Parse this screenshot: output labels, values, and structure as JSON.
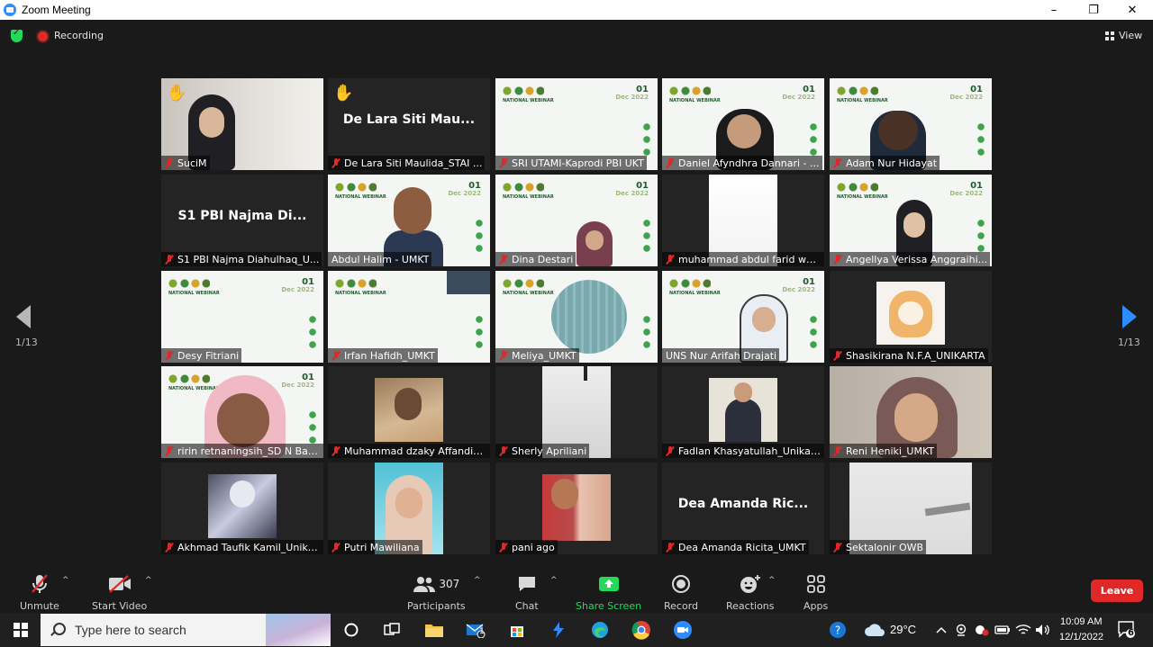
{
  "window": {
    "title": "Zoom Meeting",
    "minimize": "–",
    "maximize": "❐",
    "close": "✕"
  },
  "meeting": {
    "recording_label": "Recording",
    "view_label": "View"
  },
  "pager": {
    "left": "1/13",
    "right": "1/13"
  },
  "tiles": [
    {
      "name": "SuciM",
      "hand": true,
      "big": ""
    },
    {
      "name": "De Lara Siti Maulida_STAI ...",
      "hand": true,
      "big": "De Lara Siti Mau..."
    },
    {
      "name": "SRI UTAMI-Kaprodi PBI UKT",
      "hand": false,
      "big": ""
    },
    {
      "name": "Daniel Afyndhra Dannari - ...",
      "hand": false,
      "big": ""
    },
    {
      "name": "Adam Nur Hidayat",
      "hand": false,
      "big": ""
    },
    {
      "name": "S1 PBI Najma Diahulhaq_U...",
      "hand": false,
      "big": "S1 PBI Najma Di..."
    },
    {
      "name": "Abdul Halim - UMKT",
      "hand": false,
      "big": "",
      "active": true
    },
    {
      "name": "Dina Destari",
      "hand": false,
      "big": ""
    },
    {
      "name": "muhammad abdul farid wa...",
      "hand": false,
      "big": ""
    },
    {
      "name": "Angellya Verissa Anggraihi...",
      "hand": false,
      "big": ""
    },
    {
      "name": "Desy Fitriani",
      "hand": false,
      "big": ""
    },
    {
      "name": "Irfan Hafidh_UMKT",
      "hand": false,
      "big": ""
    },
    {
      "name": "Meliya_UMKT",
      "hand": false,
      "big": ""
    },
    {
      "name": "UNS Nur Arifah Drajati",
      "hand": false,
      "big": ""
    },
    {
      "name": "Shasikirana N.F.A_UNIKARTA",
      "hand": false,
      "big": ""
    },
    {
      "name": "ririn retnaningsih_SD N Ban...",
      "hand": false,
      "big": ""
    },
    {
      "name": "Muhammad dzaky Affandi_...",
      "hand": false,
      "big": ""
    },
    {
      "name": "Sherly Apriliani",
      "hand": false,
      "big": ""
    },
    {
      "name": "Fadlan Khasyatullah_Unikarta",
      "hand": false,
      "big": ""
    },
    {
      "name": "Reni Heniki_UMKT",
      "hand": false,
      "big": ""
    },
    {
      "name": "Akhmad Taufik Kamil_Unika...",
      "hand": false,
      "big": ""
    },
    {
      "name": "Putri Mawiliana",
      "hand": false,
      "big": ""
    },
    {
      "name": "pani ago",
      "hand": false,
      "big": ""
    },
    {
      "name": "Dea Amanda Ricita_UMKT",
      "hand": false,
      "big": "Dea Amanda Ric..."
    },
    {
      "name": "Sektalonir OWB",
      "hand": false,
      "big": ""
    }
  ],
  "webinar": {
    "heading": "NATIONAL WEBINAR",
    "date_day": "01",
    "date_month": "Dec 2022"
  },
  "controls": {
    "unmute": "Unmute",
    "start_video": "Start Video",
    "participants": "Participants",
    "participants_count": "307",
    "chat": "Chat",
    "share_screen": "Share Screen",
    "record": "Record",
    "reactions": "Reactions",
    "apps": "Apps",
    "leave": "Leave"
  },
  "taskbar": {
    "search_placeholder": "Type here to search",
    "weather_temp": "29°C",
    "time": "10:09 AM",
    "date": "12/1/2022",
    "mail_badge": "1",
    "notification_count": "6"
  },
  "colors": {
    "accent_blue": "#2d8cff",
    "danger_red": "#e02828",
    "active_speaker": "#b4e04a",
    "share_green": "#23d959"
  }
}
